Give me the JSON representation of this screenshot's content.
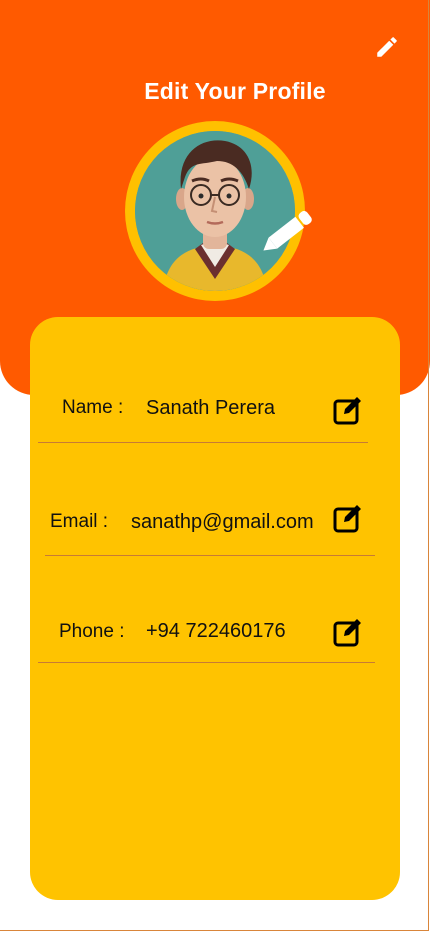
{
  "header": {
    "title": "Edit Your Profile"
  },
  "fields": {
    "name": {
      "label": "Name :",
      "value": "Sanath Perera"
    },
    "email": {
      "label": "Email :",
      "value": "sanathp@gmail.com"
    },
    "phone": {
      "label": "Phone :",
      "value": "+94 722460176"
    }
  },
  "icons": {
    "header_edit": "pencil-icon",
    "avatar_edit": "pencil-icon",
    "field_edit": "edit-square-icon"
  },
  "colors": {
    "header_bg": "#ff5a00",
    "card_bg": "#ffc300",
    "avatar_ring": "#ffc000"
  }
}
